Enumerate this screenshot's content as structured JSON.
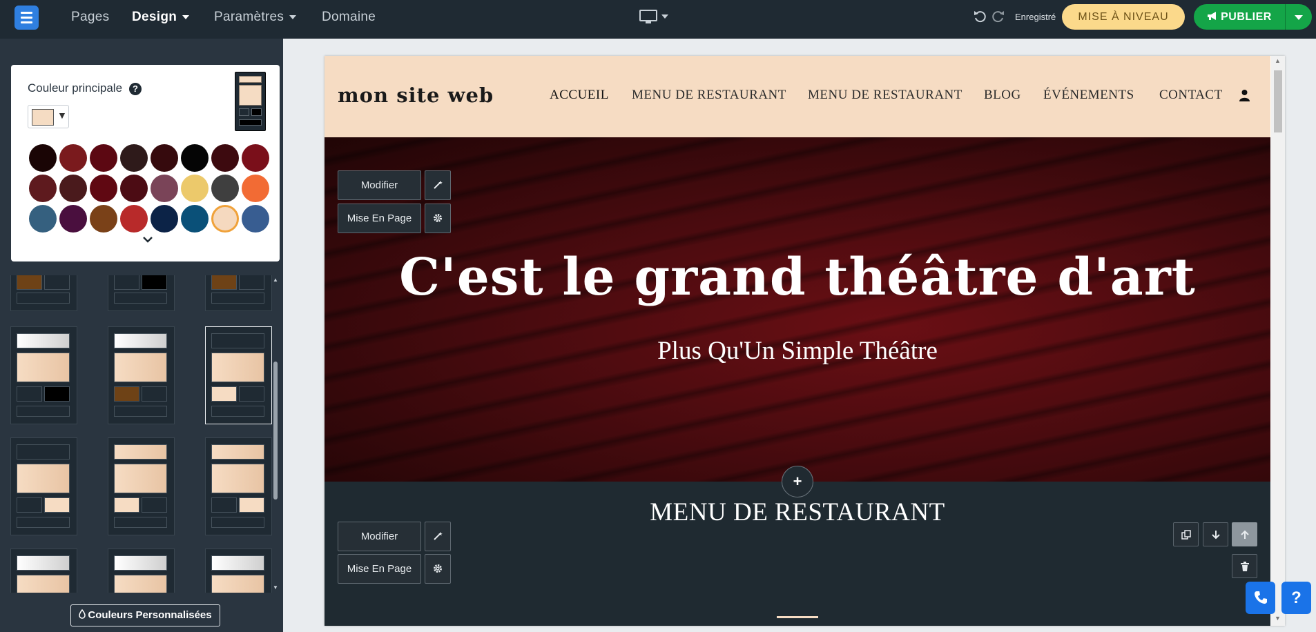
{
  "topbar": {
    "nav": [
      {
        "label": "Pages",
        "active": false,
        "dropdown": false
      },
      {
        "label": "Design",
        "active": true,
        "dropdown": true
      },
      {
        "label": "Paramètres",
        "active": false,
        "dropdown": true
      },
      {
        "label": "Domaine",
        "active": false,
        "dropdown": false
      }
    ],
    "saved_label": "Enregistré",
    "upgrade_label": "MISE À NIVEAU",
    "publish_label": "PUBLIER"
  },
  "color_panel": {
    "title": "Couleur principale",
    "help": "?",
    "selected_color": "#f5dcc3",
    "swatches": [
      "#1a0505",
      "#7a1a1d",
      "#5c0812",
      "#2e1a1a",
      "#360a0d",
      "#050505",
      "#3d0a0f",
      "#7a0f1a",
      "#5e1a1e",
      "#4a1a1c",
      "#600812",
      "#4c0c14",
      "#7a4458",
      "#ecc96b",
      "#3f3f3f",
      "#f26b34",
      "#35607f",
      "#4a0f3e",
      "#7a4118",
      "#b82a2a",
      "#0c2347",
      "#0a5078",
      "#f5d9bf",
      "#385d91"
    ]
  },
  "custom_colors_label": "Couleurs Personnalisées",
  "site": {
    "title": "mon site web",
    "nav": [
      "ACCUEIL",
      "MENU DE RESTAURANT",
      "MENU DE RESTAURANT",
      "BLOG",
      "ÉVÉNEMENTS",
      "CONTACT"
    ],
    "hero_title": "C'est le grand théâtre d'art",
    "hero_subtitle": "Plus Qu'Un Simple Théâtre",
    "section_title": "MENU DE RESTAURANT"
  },
  "editor": {
    "modify_label": "Modifier",
    "layout_label": "Mise En Page",
    "add_label": "+",
    "help_label": "?"
  },
  "colors": {
    "topbar": "#1f2a33",
    "accent_peach": "#f6dcc3",
    "publish_green": "#14a548",
    "upgrade_yellow": "#fbd98b",
    "support_blue": "#1a73e8"
  }
}
